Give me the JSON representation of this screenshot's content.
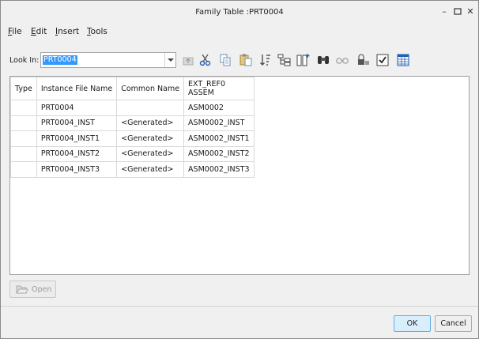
{
  "window": {
    "title": "Family Table :PRT0004",
    "controls": [
      "minimize-icon",
      "maximize-icon",
      "close-icon"
    ]
  },
  "menu": [
    {
      "label": "File",
      "mnemonic": "F",
      "rest": "ile"
    },
    {
      "label": "Edit",
      "mnemonic": "E",
      "rest": "dit"
    },
    {
      "label": "Insert",
      "mnemonic": "I",
      "rest": "nsert"
    },
    {
      "label": "Tools",
      "mnemonic": "T",
      "rest": "ools"
    }
  ],
  "toolbar": {
    "look_in_label": "Look In:",
    "look_in_value": "PRT0004",
    "icons": [
      "up-level-icon",
      "cut-icon",
      "copy-icon",
      "paste-icon",
      "sort-icon",
      "tree-icon",
      "insert-column-icon",
      "find-icon",
      "glasses-icon",
      "lock-icon",
      "verify-icon",
      "table-icon"
    ]
  },
  "table": {
    "headers": {
      "type": "Type",
      "instance": "Instance File Name",
      "common": "Common Name",
      "ref_line1": "EXT_REF0",
      "ref_line2": "ASSEM"
    },
    "rows": [
      {
        "type": "",
        "instance": "PRT0004",
        "common": "",
        "ref": "ASM0002"
      },
      {
        "type": "",
        "instance": "PRT0004_INST",
        "common": "<Generated>",
        "ref": "ASM0002_INST"
      },
      {
        "type": "",
        "instance": "PRT0004_INST1",
        "common": "<Generated>",
        "ref": "ASM0002_INST1"
      },
      {
        "type": "",
        "instance": "PRT0004_INST2",
        "common": "<Generated>",
        "ref": "ASM0002_INST2"
      },
      {
        "type": "",
        "instance": "PRT0004_INST3",
        "common": "<Generated>",
        "ref": "ASM0002_INST3"
      }
    ]
  },
  "buttons": {
    "open": "Open",
    "ok": "OK",
    "cancel": "Cancel"
  },
  "colors": {
    "ok_background": "#d9eefb",
    "ok_border": "#60b0e6",
    "selection": "#3399ff"
  }
}
